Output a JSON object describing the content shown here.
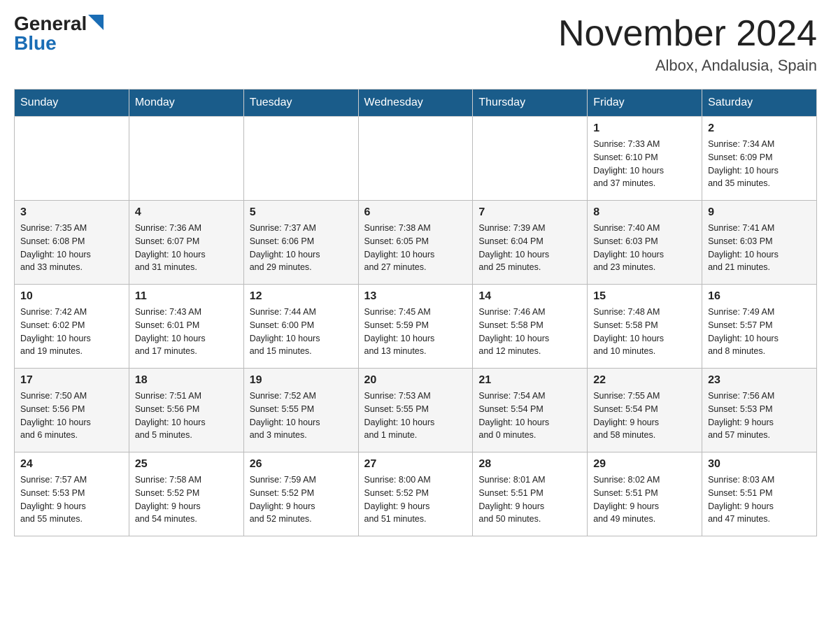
{
  "logo": {
    "general": "General",
    "blue": "Blue"
  },
  "title": "November 2024",
  "location": "Albox, Andalusia, Spain",
  "weekdays": [
    "Sunday",
    "Monday",
    "Tuesday",
    "Wednesday",
    "Thursday",
    "Friday",
    "Saturday"
  ],
  "weeks": [
    [
      {
        "day": "",
        "info": ""
      },
      {
        "day": "",
        "info": ""
      },
      {
        "day": "",
        "info": ""
      },
      {
        "day": "",
        "info": ""
      },
      {
        "day": "",
        "info": ""
      },
      {
        "day": "1",
        "info": "Sunrise: 7:33 AM\nSunset: 6:10 PM\nDaylight: 10 hours\nand 37 minutes."
      },
      {
        "day": "2",
        "info": "Sunrise: 7:34 AM\nSunset: 6:09 PM\nDaylight: 10 hours\nand 35 minutes."
      }
    ],
    [
      {
        "day": "3",
        "info": "Sunrise: 7:35 AM\nSunset: 6:08 PM\nDaylight: 10 hours\nand 33 minutes."
      },
      {
        "day": "4",
        "info": "Sunrise: 7:36 AM\nSunset: 6:07 PM\nDaylight: 10 hours\nand 31 minutes."
      },
      {
        "day": "5",
        "info": "Sunrise: 7:37 AM\nSunset: 6:06 PM\nDaylight: 10 hours\nand 29 minutes."
      },
      {
        "day": "6",
        "info": "Sunrise: 7:38 AM\nSunset: 6:05 PM\nDaylight: 10 hours\nand 27 minutes."
      },
      {
        "day": "7",
        "info": "Sunrise: 7:39 AM\nSunset: 6:04 PM\nDaylight: 10 hours\nand 25 minutes."
      },
      {
        "day": "8",
        "info": "Sunrise: 7:40 AM\nSunset: 6:03 PM\nDaylight: 10 hours\nand 23 minutes."
      },
      {
        "day": "9",
        "info": "Sunrise: 7:41 AM\nSunset: 6:03 PM\nDaylight: 10 hours\nand 21 minutes."
      }
    ],
    [
      {
        "day": "10",
        "info": "Sunrise: 7:42 AM\nSunset: 6:02 PM\nDaylight: 10 hours\nand 19 minutes."
      },
      {
        "day": "11",
        "info": "Sunrise: 7:43 AM\nSunset: 6:01 PM\nDaylight: 10 hours\nand 17 minutes."
      },
      {
        "day": "12",
        "info": "Sunrise: 7:44 AM\nSunset: 6:00 PM\nDaylight: 10 hours\nand 15 minutes."
      },
      {
        "day": "13",
        "info": "Sunrise: 7:45 AM\nSunset: 5:59 PM\nDaylight: 10 hours\nand 13 minutes."
      },
      {
        "day": "14",
        "info": "Sunrise: 7:46 AM\nSunset: 5:58 PM\nDaylight: 10 hours\nand 12 minutes."
      },
      {
        "day": "15",
        "info": "Sunrise: 7:48 AM\nSunset: 5:58 PM\nDaylight: 10 hours\nand 10 minutes."
      },
      {
        "day": "16",
        "info": "Sunrise: 7:49 AM\nSunset: 5:57 PM\nDaylight: 10 hours\nand 8 minutes."
      }
    ],
    [
      {
        "day": "17",
        "info": "Sunrise: 7:50 AM\nSunset: 5:56 PM\nDaylight: 10 hours\nand 6 minutes."
      },
      {
        "day": "18",
        "info": "Sunrise: 7:51 AM\nSunset: 5:56 PM\nDaylight: 10 hours\nand 5 minutes."
      },
      {
        "day": "19",
        "info": "Sunrise: 7:52 AM\nSunset: 5:55 PM\nDaylight: 10 hours\nand 3 minutes."
      },
      {
        "day": "20",
        "info": "Sunrise: 7:53 AM\nSunset: 5:55 PM\nDaylight: 10 hours\nand 1 minute."
      },
      {
        "day": "21",
        "info": "Sunrise: 7:54 AM\nSunset: 5:54 PM\nDaylight: 10 hours\nand 0 minutes."
      },
      {
        "day": "22",
        "info": "Sunrise: 7:55 AM\nSunset: 5:54 PM\nDaylight: 9 hours\nand 58 minutes."
      },
      {
        "day": "23",
        "info": "Sunrise: 7:56 AM\nSunset: 5:53 PM\nDaylight: 9 hours\nand 57 minutes."
      }
    ],
    [
      {
        "day": "24",
        "info": "Sunrise: 7:57 AM\nSunset: 5:53 PM\nDaylight: 9 hours\nand 55 minutes."
      },
      {
        "day": "25",
        "info": "Sunrise: 7:58 AM\nSunset: 5:52 PM\nDaylight: 9 hours\nand 54 minutes."
      },
      {
        "day": "26",
        "info": "Sunrise: 7:59 AM\nSunset: 5:52 PM\nDaylight: 9 hours\nand 52 minutes."
      },
      {
        "day": "27",
        "info": "Sunrise: 8:00 AM\nSunset: 5:52 PM\nDaylight: 9 hours\nand 51 minutes."
      },
      {
        "day": "28",
        "info": "Sunrise: 8:01 AM\nSunset: 5:51 PM\nDaylight: 9 hours\nand 50 minutes."
      },
      {
        "day": "29",
        "info": "Sunrise: 8:02 AM\nSunset: 5:51 PM\nDaylight: 9 hours\nand 49 minutes."
      },
      {
        "day": "30",
        "info": "Sunrise: 8:03 AM\nSunset: 5:51 PM\nDaylight: 9 hours\nand 47 minutes."
      }
    ]
  ]
}
